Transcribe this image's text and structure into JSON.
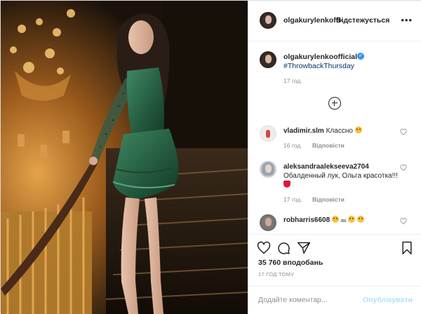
{
  "post": {
    "author": "olgakurylenkoofficial",
    "author_truncated": "olgakurylenkoffi·",
    "follow_label": "Відстежується",
    "more_label": "•••",
    "caption_hashtag": "#ThrowbackThursday",
    "caption_time": "17 год.",
    "likes": "35 760 вподобань",
    "time_ago": "17 год тому",
    "comment_placeholder": "Додайте коментар...",
    "publish_label": "Опублікувати"
  },
  "comments": [
    {
      "user": "vladimir.slm",
      "text": "Классно",
      "time": "16 год.",
      "reply": "Відповісти"
    },
    {
      "user": "aleksandraalekseeva2704",
      "text": "Обалденный лук, Ольга красотка!!!",
      "time": "17 год.",
      "reply": "Відповісти"
    },
    {
      "user": "robharris6608",
      "text": "au",
      "time": "",
      "reply": ""
    }
  ],
  "colors": {
    "link": "#00376b",
    "verified": "#3897f0",
    "publish_disabled": "#b2dffc",
    "muted": "#8e8e8e",
    "dress": "#2f6a4d"
  },
  "icons": [
    "more-options-icon",
    "verified-badge-icon",
    "load-more-comments-icon",
    "heart-icon",
    "comment-icon",
    "share-icon",
    "bookmark-icon"
  ]
}
